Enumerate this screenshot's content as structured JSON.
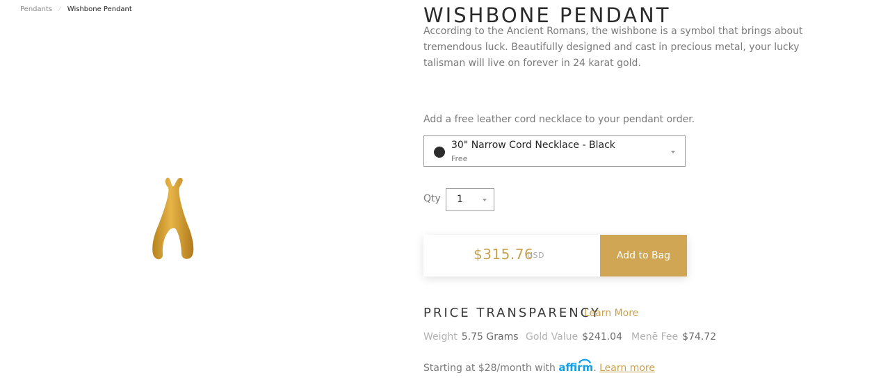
{
  "breadcrumb": {
    "parent": "Pendants",
    "separator": "⁄",
    "current": "Wishbone Pendant"
  },
  "product": {
    "title": "WISHBONE PENDANT",
    "description": "According to the Ancient Romans, the wishbone is a symbol that brings about tremendous luck. Beautifully designed and cast in precious metal, your lucky talisman will live on forever in 24 karat gold.",
    "image_color": "#d2a032"
  },
  "cord": {
    "prompt": "Add a free leather cord necklace to your pendant order.",
    "selected_name": "30\" Narrow Cord Necklace - Black",
    "selected_price": "Free",
    "swatch_color": "#2c2c2c"
  },
  "qty": {
    "label": "Qty",
    "value": "1"
  },
  "purchase": {
    "price": "$315.76",
    "currency": "USD",
    "button_label": "Add to Bag",
    "button_color": "#d0a553"
  },
  "transparency": {
    "heading": "PRICE TRANSPARENCY",
    "learn_more": "Learn More",
    "items": [
      {
        "label": "Weight",
        "value": "5.75 Grams"
      },
      {
        "label": "Gold Value",
        "value": "$241.04"
      },
      {
        "label": "Menē Fee",
        "value": "$74.72"
      }
    ]
  },
  "financing": {
    "prefix": "Starting at $28/month with",
    "brand": "affirm",
    "suffix": ".",
    "learn_more": "Learn more"
  },
  "colors": {
    "accent": "#c9a24f",
    "affirm_blue": "#0fa0ea"
  }
}
